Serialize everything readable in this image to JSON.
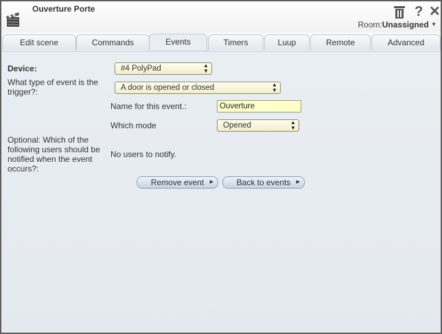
{
  "window": {
    "title": "Ouverture Porte",
    "room_label": "Room:",
    "room_value": "Unassigned"
  },
  "icons": {
    "delete": "trash-icon",
    "help": "?",
    "close": "✕"
  },
  "tabs": [
    {
      "label": "Edit scene"
    },
    {
      "label": "Commands"
    },
    {
      "label": "Events"
    },
    {
      "label": "Timers"
    },
    {
      "label": "Luup"
    },
    {
      "label": "Remote"
    },
    {
      "label": "Advanced"
    }
  ],
  "form": {
    "device_label": "Device:",
    "device_value": "#4 PolyPad",
    "trigger_label": "What type of event is the trigger?:",
    "trigger_value": "A door is opened or closed",
    "name_label": "Name for this event.:",
    "name_value": "Ouverture",
    "mode_label": "Which mode",
    "mode_value": "Opened",
    "notify_label": "Optional: Which of the following users should be notified when the event occurs?:",
    "notify_value": "No users to notify."
  },
  "buttons": {
    "remove": "Remove event",
    "back": "Back to events"
  }
}
